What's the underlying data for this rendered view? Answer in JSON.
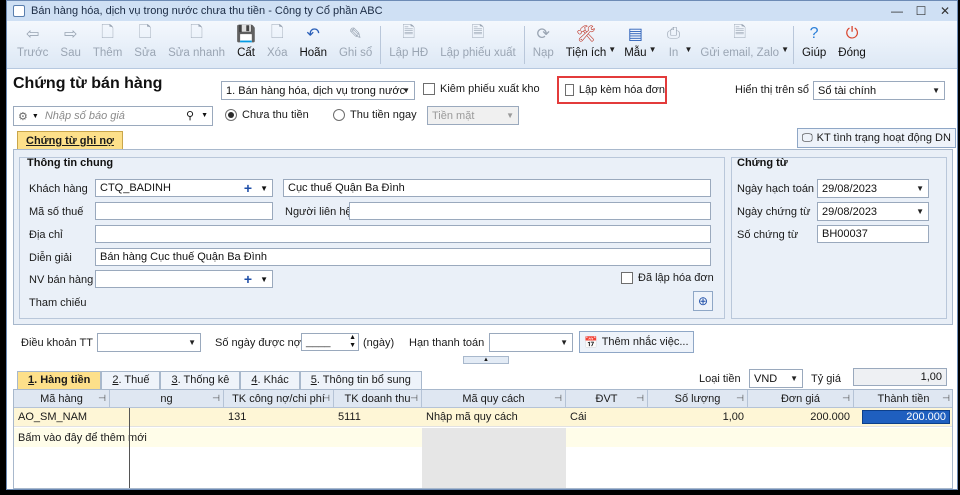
{
  "window": {
    "title": "Bán hàng hóa, dịch vụ trong nước chưa thu tiền - Công ty Cổ phần ABC"
  },
  "toolbar": [
    {
      "label": "Trước",
      "icon": "arrow-left-icon",
      "glyph": "⇦",
      "enabled": false
    },
    {
      "label": "Sau",
      "icon": "arrow-right-icon",
      "glyph": "⇨",
      "enabled": false
    },
    {
      "label": "Thêm",
      "icon": "add-doc-icon",
      "glyph": "🗋",
      "enabled": false
    },
    {
      "label": "Sửa",
      "icon": "edit-doc-icon",
      "glyph": "🗋",
      "enabled": false
    },
    {
      "label": "Sửa nhanh",
      "icon": "quick-edit-icon",
      "glyph": "🗋",
      "enabled": false
    },
    {
      "label": "Cất",
      "icon": "save-icon",
      "glyph": "💾",
      "enabled": true
    },
    {
      "label": "Xóa",
      "icon": "delete-doc-icon",
      "glyph": "🗋",
      "enabled": false
    },
    {
      "label": "Hoãn",
      "icon": "undo-icon",
      "glyph": "↶",
      "enabled": true
    },
    {
      "label": "Ghi sổ",
      "icon": "pen-icon",
      "glyph": "✎",
      "enabled": false
    },
    {
      "label": "Lập HĐ",
      "icon": "invoice-icon",
      "glyph": "🗎",
      "enabled": false
    },
    {
      "label": "Lập phiếu xuất",
      "icon": "export-slip-icon",
      "glyph": "🗎",
      "enabled": false
    },
    {
      "label": "Nạp",
      "icon": "reload-icon",
      "glyph": "⟳",
      "enabled": false
    },
    {
      "label": "Tiện ích",
      "icon": "tools-icon",
      "glyph": "🛠",
      "enabled": true,
      "caret": true
    },
    {
      "label": "Mẫu",
      "icon": "template-icon",
      "glyph": "▤",
      "enabled": true,
      "caret": true
    },
    {
      "label": "In",
      "icon": "print-icon",
      "glyph": "⎙",
      "enabled": false,
      "caret": true
    },
    {
      "label": "Gửi email, Zalo",
      "icon": "email-icon",
      "glyph": "🗎",
      "enabled": false,
      "caret": true
    },
    {
      "label": "Giúp",
      "icon": "help-icon",
      "glyph": "?",
      "enabled": true
    },
    {
      "label": "Đóng",
      "icon": "close-circle-icon",
      "glyph": "⏻",
      "enabled": true
    }
  ],
  "header": {
    "doc_title": "Chứng từ bán hàng",
    "doc_type": "1. Bán hàng hóa, dịch vụ trong nước",
    "kiem_phieu_xuat_kho": "Kiêm phiếu xuất kho",
    "lap_kem_hoa_don": "Lập kèm hóa đơn",
    "hien_thi_tren_so_label": "Hiển thị trên sổ",
    "hien_thi_tren_so_value": "Sổ tài chính",
    "quote_placeholder": "Nhập số báo giá",
    "chua_thu_tien": "Chưa thu tiền",
    "thu_tien_ngay": "Thu tiền ngay",
    "payment_method": "Tiền mặt"
  },
  "tabs_top": {
    "active": "Chứng từ ghi nợ",
    "kt_button": "KT tình trạng hoạt động DN"
  },
  "general": {
    "title": "Thông tin chung",
    "khach_hang_label": "Khách hàng",
    "khach_hang_code": "CTQ_BADINH",
    "khach_hang_name": "Cục thuế Quận Ba Đình",
    "ma_so_thue_label": "Mã số thuế",
    "nguoi_lien_he_label": "Người liên hệ",
    "dia_chi_label": "Địa chỉ",
    "dien_giai_label": "Diễn giải",
    "dien_giai_value": "Bán hàng Cục thuế Quận Ba Đình",
    "nv_ban_hang_label": "NV bán hàng",
    "da_lap_hoa_don": "Đã lập hóa đơn",
    "tham_chieu_label": "Tham chiếu"
  },
  "voucher": {
    "title": "Chứng từ",
    "ngay_hach_toan_label": "Ngày hạch toán",
    "ngay_hach_toan": "29/08/2023",
    "ngay_chung_tu_label": "Ngày chứng từ",
    "ngay_chung_tu": "29/08/2023",
    "so_chung_tu_label": "Số chứng từ",
    "so_chung_tu": "BH00037"
  },
  "terms": {
    "dieu_khoan_label": "Điều khoản TT",
    "so_ngay_label": "Số ngày được nợ",
    "so_ngay_value": "____",
    "ngay_unit": "(ngày)",
    "han_thanh_toan_label": "Hạn thanh toán",
    "them_nhac_viec": "Thêm nhắc việc..."
  },
  "bottom_tabs": [
    {
      "num": "1",
      "label": ". Hàng tiền",
      "active": true
    },
    {
      "num": "2",
      "label": ". Thuế",
      "active": false
    },
    {
      "num": "3",
      "label": ". Thống kê",
      "active": false
    },
    {
      "num": "4",
      "label": ". Khác",
      "active": false
    },
    {
      "num": "5",
      "label": ". Thông tin bổ sung",
      "active": false
    }
  ],
  "currency": {
    "loai_tien_label": "Loại tiền",
    "loai_tien": "VND",
    "ty_gia_label": "Tỷ giá",
    "ty_gia": "1,00"
  },
  "grid": {
    "columns": [
      "Mã hàng",
      "ng",
      "TK công nợ/chi phí",
      "TK doanh thu",
      "Mã quy cách",
      "ĐVT",
      "Số lượng",
      "Đơn giá",
      "Thành tiền"
    ],
    "rows": [
      {
        "ma_hang": "AO_SM_NAM",
        "tk_cong_no": "131",
        "tk_doanh_thu": "5111",
        "ma_quy_cach": "Nhập mã quy cách",
        "dvt": "Cái",
        "so_luong": "1,00",
        "don_gia": "200.000",
        "thanh_tien": "200.000"
      }
    ],
    "add_new": "Bấm vào đây để thêm mới"
  }
}
